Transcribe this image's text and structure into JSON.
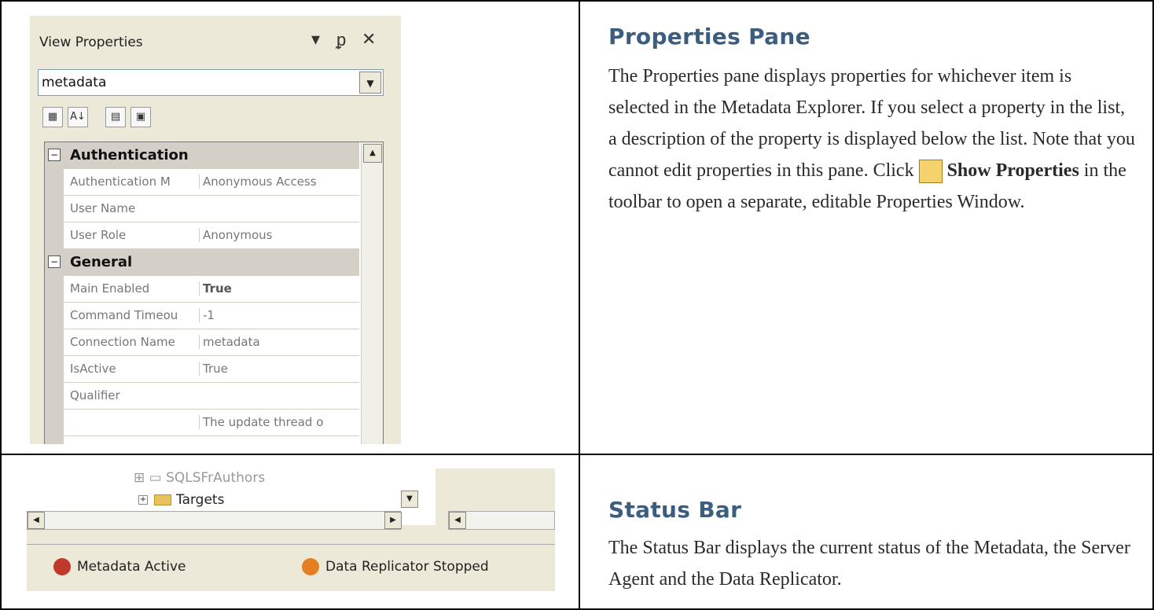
{
  "properties_section": {
    "title": "Properties Pane",
    "desc_part1": "The Properties pane displays properties for whichever item is selected in the Metadata Explorer. If you select a property in the list, a description of the property is displayed below the list. Note that you cannot edit properties in this pane. Click ",
    "desc_bold": "Show Properties",
    "desc_part2": " in the toolbar to open a separate, editable Properties Window."
  },
  "status_section": {
    "title": "Status Bar",
    "desc": "The Status Bar displays the current status of the Metadata, the Server Agent and the Data Replicator."
  },
  "pane": {
    "title": "View Properties",
    "pin_icon": "pin-icon",
    "close_icon": "close-icon",
    "dropdown_icon": "chevron-down-icon",
    "combo_value": "metadata",
    "categories": [
      {
        "toggle": "⊟",
        "name": "Authentication",
        "rows": [
          {
            "name": "Authentication M",
            "value": "Anonymous Access",
            "bold": false
          },
          {
            "name": "User Name",
            "value": "",
            "bold": false
          },
          {
            "name": "User Role",
            "value": "Anonymous",
            "bold": false
          }
        ]
      },
      {
        "toggle": "⊟",
        "name": "General",
        "rows": [
          {
            "name": "Main Enabled",
            "value": "True",
            "bold": true
          },
          {
            "name": "Command Timeou",
            "value": "-1",
            "bold": false
          },
          {
            "name": "Connection Name",
            "value": "metadata",
            "bold": false
          },
          {
            "name": "IsActive",
            "value": "True",
            "bold": false
          },
          {
            "name": "Qualifier",
            "value": "",
            "bold": false
          },
          {
            "name": "",
            "value": "The update thread o",
            "bold": false
          }
        ]
      }
    ]
  },
  "statusbar": {
    "tree_item": "Targets",
    "metadata_status": "Metadata Active",
    "replicator_status": "Data Replicator Stopped",
    "metadata_icon_color": "#c0392b",
    "replicator_icon_color": "#e67e22"
  }
}
